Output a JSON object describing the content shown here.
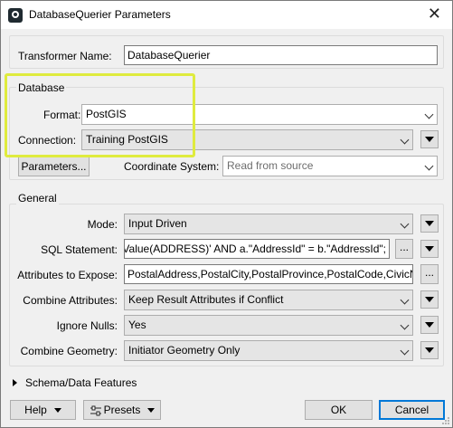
{
  "window": {
    "title": "DatabaseQuerier Parameters",
    "close_glyph": "✕"
  },
  "transformer": {
    "label": "Transformer Name:",
    "value": "DatabaseQuerier"
  },
  "database": {
    "group_title": "Database",
    "format_label": "Format:",
    "format_value": "PostGIS",
    "connection_label": "Connection:",
    "connection_value": "Training PostGIS",
    "parameters_button": "Parameters...",
    "coordsys_label": "Coordinate System:",
    "coordsys_placeholder": "Read from source"
  },
  "general": {
    "group_title": "General",
    "mode_label": "Mode:",
    "mode_value": "Input Driven",
    "sql_label": "SQL Statement:",
    "sql_value": "@Value(ADDRESS)'  AND a.\"AddressId\" = b.\"AddressId\";",
    "attrs_label": "Attributes to Expose:",
    "attrs_value": "PostalAddress,PostalCity,PostalProvince,PostalCode,CivicNo",
    "combine_attrs_label": "Combine Attributes:",
    "combine_attrs_value": "Keep Result Attributes if Conflict",
    "ignore_nulls_label": "Ignore Nulls:",
    "ignore_nulls_value": "Yes",
    "combine_geom_label": "Combine Geometry:",
    "combine_geom_value": "Initiator Geometry Only",
    "ellipsis": "..."
  },
  "schema": {
    "label": "Schema/Data Features"
  },
  "footer": {
    "help": "Help",
    "presets": "Presets",
    "ok": "OK",
    "cancel": "Cancel"
  },
  "icons": {
    "app": "fme-app-icon",
    "close": "close-icon",
    "dropdown": "chevron-down-icon",
    "menu": "menu-arrow-icon",
    "expand": "expand-arrow-icon",
    "presets": "sliders-icon"
  },
  "colors": {
    "highlight": "#dfeb3e",
    "default_button_border": "#0078d7"
  }
}
